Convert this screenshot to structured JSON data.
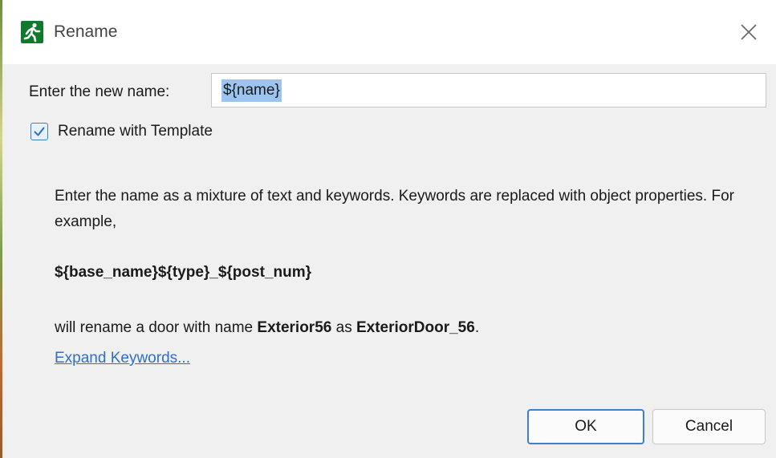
{
  "window": {
    "title": "Rename",
    "app_icon": "running-man-icon",
    "close_icon": "close-icon"
  },
  "form": {
    "name_label": "Enter the new name:",
    "name_value": "${name}",
    "template_checkbox_label": "Rename with Template",
    "template_checked": true
  },
  "help": {
    "intro": "Enter the name as a mixture of text and keywords. Keywords are replaced with object properties. For example,",
    "template_example": "${base_name}${type}_${post_num}",
    "example_prefix": "will rename a door with name ",
    "example_old_name": "Exterior56",
    "example_middle": " as ",
    "example_new_name": "ExteriorDoor_56",
    "example_suffix": ".",
    "expand_link": "Expand Keywords..."
  },
  "buttons": {
    "ok": "OK",
    "cancel": "Cancel"
  },
  "colors": {
    "accent": "#3c7fd0",
    "link": "#2f6fc9",
    "icon_green": "#0f7a2e",
    "selection": "#9cc4f0"
  }
}
